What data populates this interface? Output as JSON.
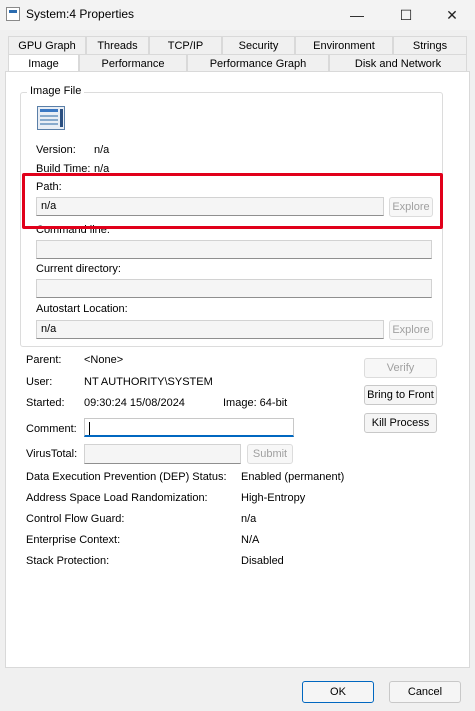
{
  "window": {
    "title": "System:4 Properties",
    "controls": {
      "minimize": "—",
      "maximize": "☐",
      "close": "✕"
    }
  },
  "tabs": {
    "row1": [
      "GPU Graph",
      "Threads",
      "TCP/IP",
      "Security",
      "Environment",
      "Strings"
    ],
    "row2": [
      "Image",
      "Performance",
      "Performance Graph",
      "Disk and Network"
    ],
    "active": "Image"
  },
  "image_file": {
    "group_label": "Image File",
    "icon": "executable-icon",
    "version_label": "Version:",
    "version_value": "n/a",
    "build_time_label": "Build Time:",
    "build_time_value": "n/a",
    "path_label": "Path:",
    "path_value": "n/a",
    "command_line_label": "Command line:",
    "command_line_value": "",
    "current_directory_label": "Current directory:",
    "current_directory_value": "",
    "autostart_label": "Autostart Location:",
    "autostart_value": "n/a",
    "explore_label": "Explore"
  },
  "process": {
    "parent_label": "Parent:",
    "parent_value": "<None>",
    "user_label": "User:",
    "user_value": "NT AUTHORITY\\SYSTEM",
    "started_label": "Started:",
    "started_value": "09:30:24  15/08/2024",
    "image_value": "Image: 64-bit",
    "comment_label": "Comment:",
    "comment_value": "",
    "virustotal_label": "VirusTotal:",
    "submit_label": "Submit",
    "verify_label": "Verify",
    "bring_to_front_label": "Bring to Front",
    "kill_process_label": "Kill Process"
  },
  "security": [
    {
      "label": "Data Execution Prevention (DEP) Status:",
      "value": "Enabled (permanent)"
    },
    {
      "label": "Address Space Load Randomization:",
      "value": "High-Entropy"
    },
    {
      "label": "Control Flow Guard:",
      "value": "n/a"
    },
    {
      "label": "Enterprise Context:",
      "value": "N/A"
    },
    {
      "label": "Stack Protection:",
      "value": "Disabled"
    }
  ],
  "footer": {
    "ok_label": "OK",
    "cancel_label": "Cancel"
  },
  "colors": {
    "highlight": "#e1001a",
    "accent": "#0067c0"
  }
}
